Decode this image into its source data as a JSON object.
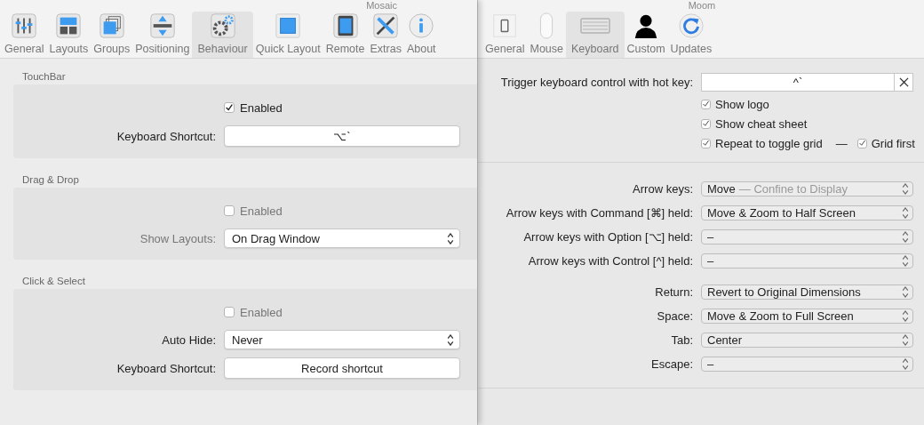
{
  "left_window": {
    "title": "Mosaic",
    "toolbar": [
      {
        "label": "General",
        "selected": false
      },
      {
        "label": "Layouts",
        "selected": false
      },
      {
        "label": "Groups",
        "selected": false
      },
      {
        "label": "Positioning",
        "selected": false
      },
      {
        "label": "Behaviour",
        "selected": true
      },
      {
        "label": "Quick Layout",
        "selected": false
      },
      {
        "label": "Remote",
        "selected": false
      },
      {
        "label": "Extras",
        "selected": false
      },
      {
        "label": "About",
        "selected": false
      }
    ],
    "groups": [
      {
        "title": "TouchBar",
        "rows": [
          {
            "kind": "checkbox",
            "label": "Enabled",
            "checked": true
          },
          {
            "kind": "shortcut",
            "label": "Keyboard Shortcut:",
            "value": "⌥`"
          }
        ]
      },
      {
        "title": "Drag & Drop",
        "rows": [
          {
            "kind": "checkbox",
            "label": "Enabled",
            "checked": false
          },
          {
            "kind": "select",
            "label": "Show Layouts:",
            "value": "On Drag Window",
            "disabled": true
          }
        ]
      },
      {
        "title": "Click & Select",
        "rows": [
          {
            "kind": "checkbox",
            "label": "Enabled",
            "checked": false
          },
          {
            "kind": "select",
            "label": "Auto Hide:",
            "value": "Never",
            "disabled": false
          },
          {
            "kind": "shortcut",
            "label": "Keyboard Shortcut:",
            "value": "Record shortcut"
          }
        ]
      }
    ]
  },
  "right_window": {
    "title": "Moom",
    "toolbar": [
      {
        "label": "General",
        "selected": false
      },
      {
        "label": "Mouse",
        "selected": false
      },
      {
        "label": "Keyboard",
        "selected": true
      },
      {
        "label": "Custom",
        "selected": false
      },
      {
        "label": "Updates",
        "selected": false
      }
    ],
    "hotkey": {
      "label": "Trigger keyboard control with hot key:",
      "value": "^`"
    },
    "options": [
      {
        "items": [
          {
            "label": "Show logo",
            "checked": true
          }
        ]
      },
      {
        "items": [
          {
            "label": "Show cheat sheet",
            "checked": true
          }
        ]
      },
      {
        "separator": "—",
        "items": [
          {
            "label": "Repeat to toggle grid",
            "checked": true
          },
          {
            "label": "Grid first",
            "checked": true
          }
        ]
      }
    ],
    "select_groups": [
      [
        {
          "label": "Arrow keys:",
          "value": "Move",
          "detail": "— Confine to Display"
        },
        {
          "label": "Arrow keys with Command [⌘] held:",
          "value": "Move & Zoom to Half Screen"
        },
        {
          "label": "Arrow keys with Option [⌥] held:",
          "value": "–"
        },
        {
          "label": "Arrow keys with Control [^] held:",
          "value": "–"
        }
      ],
      [
        {
          "label": "Return:",
          "value": "Revert to Original Dimensions"
        },
        {
          "label": "Space:",
          "value": "Move & Zoom to Full Screen"
        },
        {
          "label": "Tab:",
          "value": "Center"
        },
        {
          "label": "Escape:",
          "value": "–"
        }
      ]
    ]
  }
}
